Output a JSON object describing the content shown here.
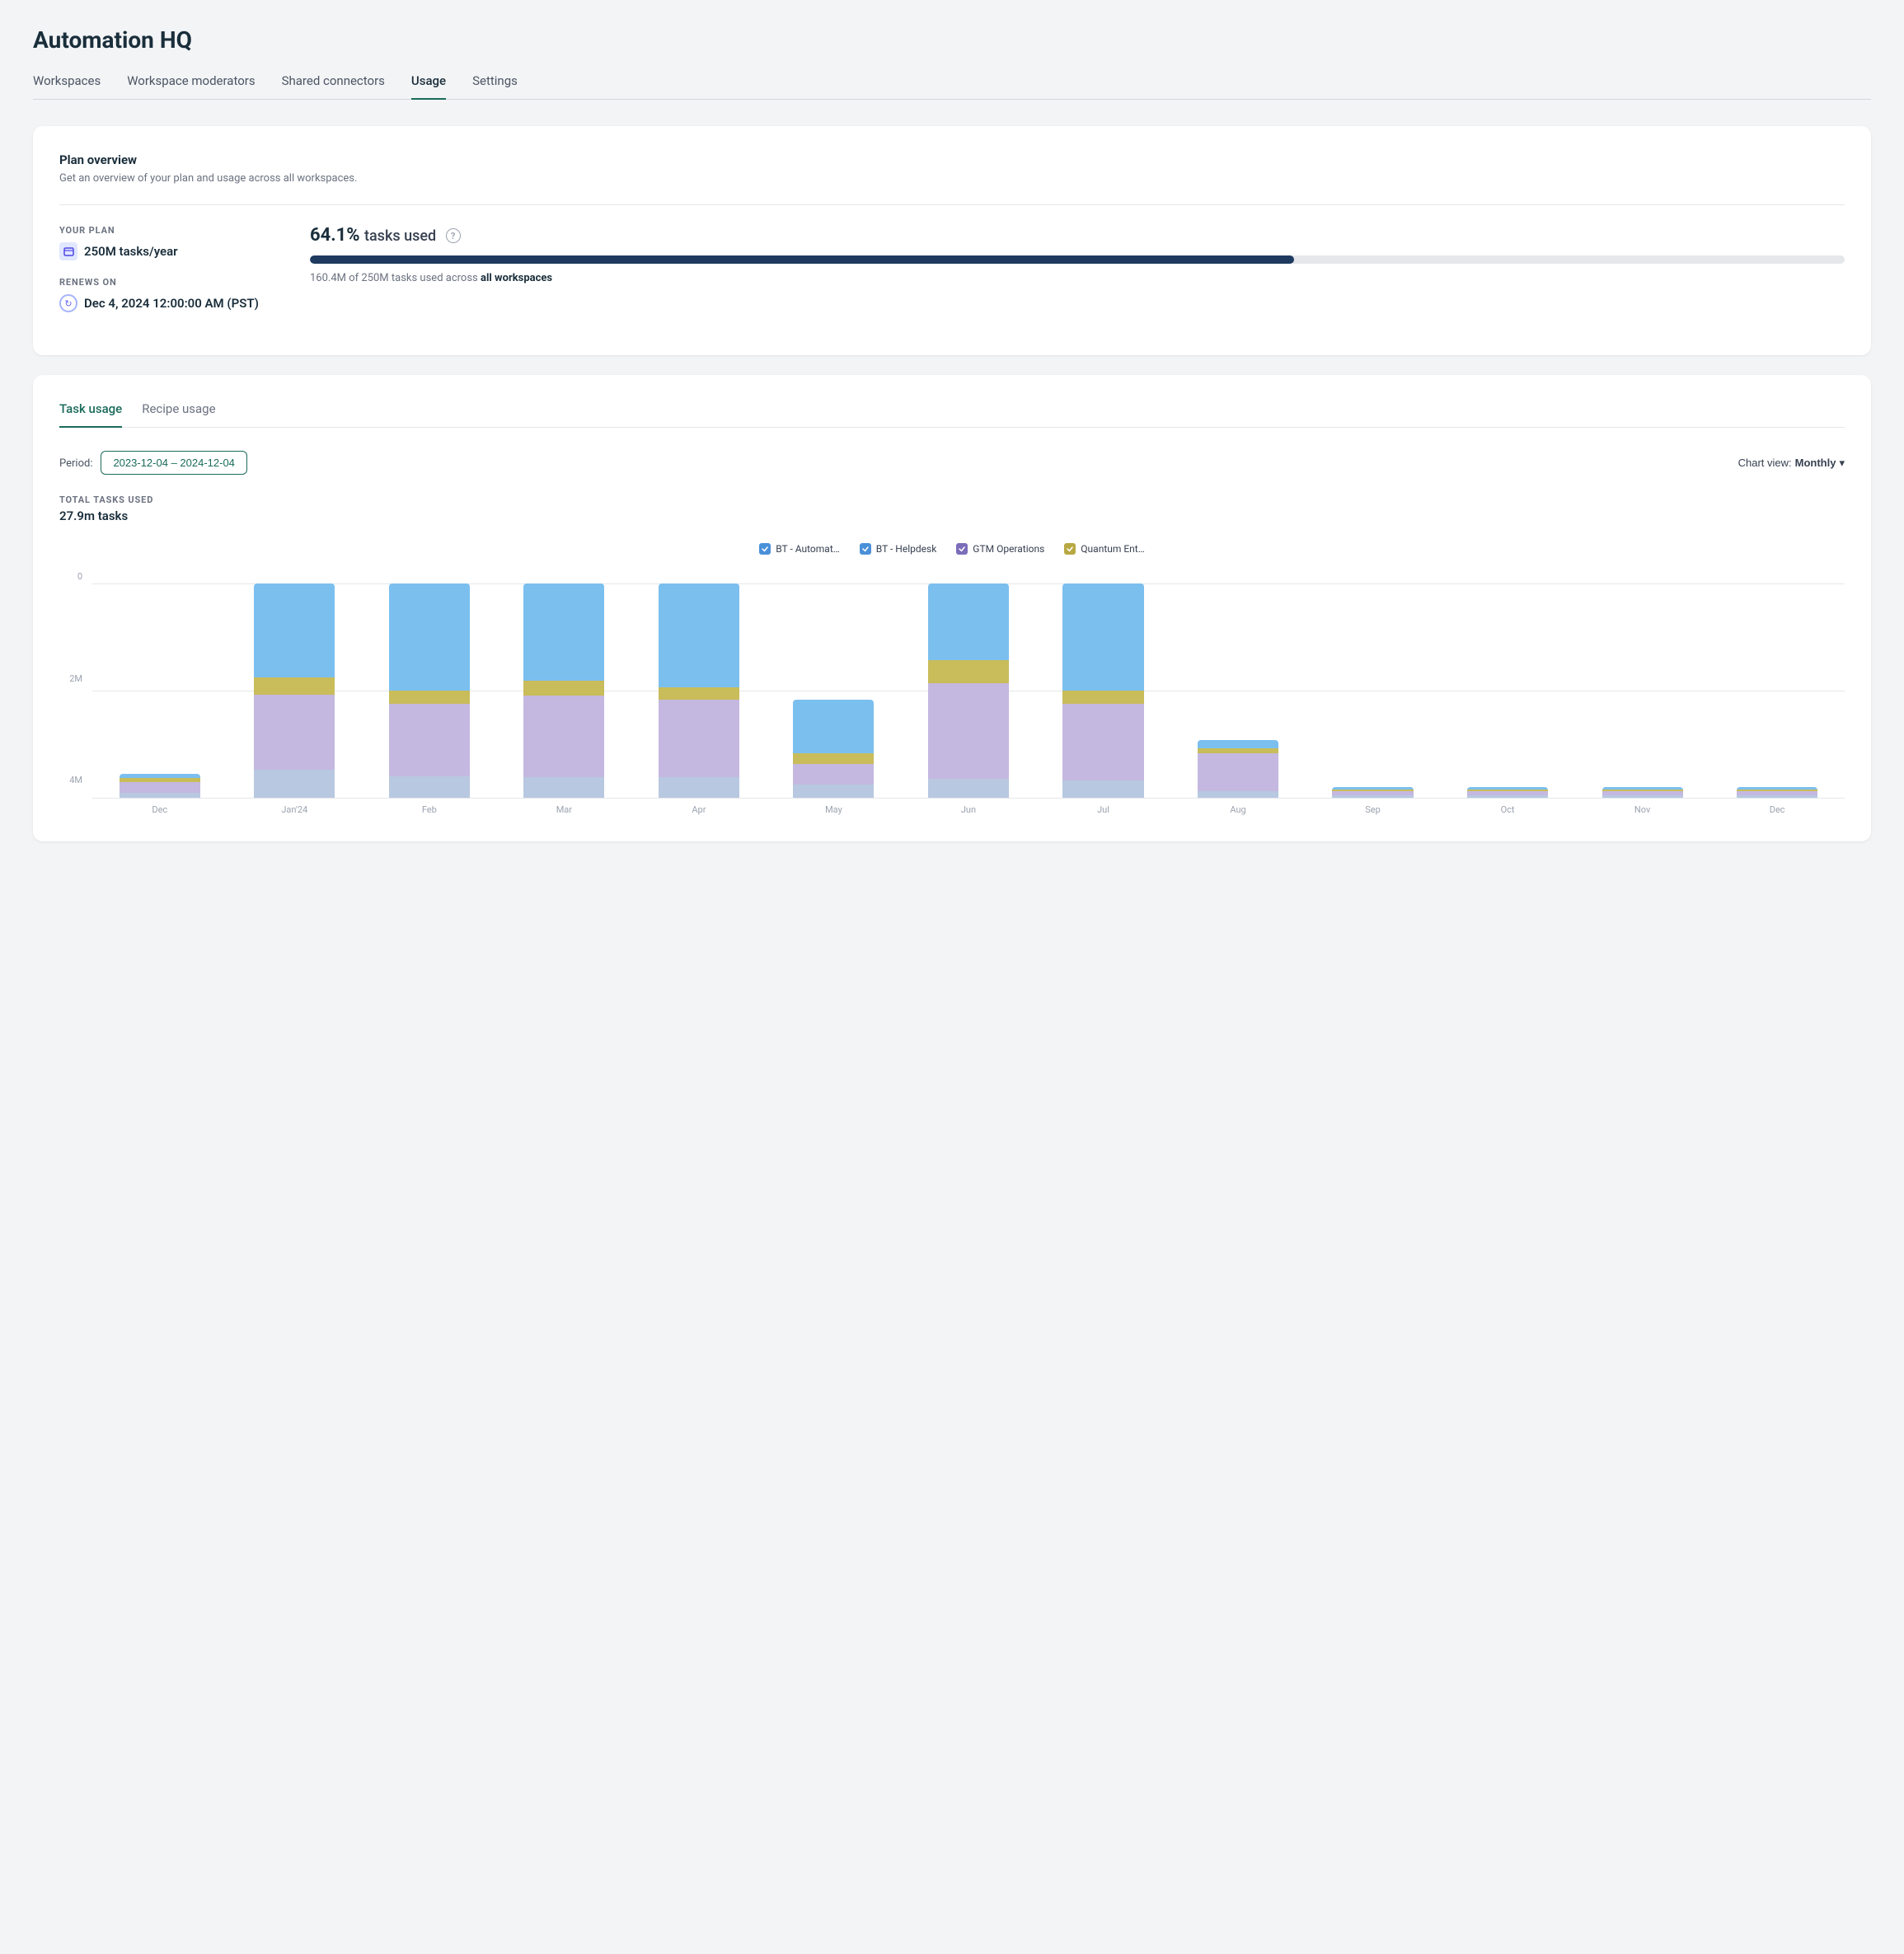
{
  "page": {
    "title": "Automation HQ"
  },
  "nav": {
    "tabs": [
      {
        "id": "workspaces",
        "label": "Workspaces",
        "active": false
      },
      {
        "id": "workspace-moderators",
        "label": "Workspace moderators",
        "active": false
      },
      {
        "id": "shared-connectors",
        "label": "Shared connectors",
        "active": false
      },
      {
        "id": "usage",
        "label": "Usage",
        "active": true
      },
      {
        "id": "settings",
        "label": "Settings",
        "active": false
      }
    ]
  },
  "plan_overview": {
    "title": "Plan overview",
    "description": "Get an overview of your plan and usage across all workspaces.",
    "your_plan_label": "YOUR PLAN",
    "plan_value": "250M tasks/year",
    "renews_on_label": "RENEWS ON",
    "renews_value": "Dec 4, 2024 12:00:00 AM (PST)",
    "usage_pct": "64.1%",
    "usage_label": "tasks used",
    "progress_pct": 64.1,
    "usage_detail": "160.4M of 250M tasks used across",
    "usage_detail_bold": "all workspaces"
  },
  "task_usage": {
    "tabs": [
      {
        "id": "task-usage",
        "label": "Task usage",
        "active": true
      },
      {
        "id": "recipe-usage",
        "label": "Recipe usage",
        "active": false
      }
    ],
    "period_label": "Period:",
    "period_value": "2023-12-04 – 2024-12-04",
    "chart_view_label": "Chart view:",
    "chart_view_value": "Monthly",
    "total_label": "TOTAL TASKS USED",
    "total_value": "27.9m tasks",
    "legend": [
      {
        "id": "bt-auto",
        "label": "BT - Automat…",
        "color": "#4a90d9"
      },
      {
        "id": "bt-helpdesk",
        "label": "BT - Helpdesk",
        "color": "#4a90d9"
      },
      {
        "id": "gtm-ops",
        "label": "GTM Operations",
        "color": "#7c6dba"
      },
      {
        "id": "quantum",
        "label": "Quantum Ent…",
        "color": "#b8a842"
      }
    ],
    "x_labels": [
      "Dec",
      "Jan'24",
      "Feb",
      "Mar",
      "Apr",
      "May",
      "Jun",
      "Jul",
      "Aug",
      "Sep",
      "Oct",
      "Nov",
      "Dec"
    ],
    "y_labels": [
      "0",
      "2M",
      "4M"
    ],
    "bars": [
      {
        "month": "Dec",
        "segments": [
          {
            "color": "#b8c8e0",
            "h": 4
          },
          {
            "color": "#c4b8e0",
            "h": 8
          },
          {
            "color": "#c9bc5a",
            "h": 3
          },
          {
            "color": "#7bbfef",
            "h": 3
          }
        ]
      },
      {
        "month": "Jan'24",
        "segments": [
          {
            "color": "#b8c8e0",
            "h": 30
          },
          {
            "color": "#c4b8e0",
            "h": 80
          },
          {
            "color": "#c9bc5a",
            "h": 18
          },
          {
            "color": "#7bbfef",
            "h": 100
          }
        ]
      },
      {
        "month": "Feb",
        "segments": [
          {
            "color": "#b8c8e0",
            "h": 25
          },
          {
            "color": "#c4b8e0",
            "h": 85
          },
          {
            "color": "#c9bc5a",
            "h": 16
          },
          {
            "color": "#7bbfef",
            "h": 125
          }
        ]
      },
      {
        "month": "Mar",
        "segments": [
          {
            "color": "#b8c8e0",
            "h": 20
          },
          {
            "color": "#c4b8e0",
            "h": 80
          },
          {
            "color": "#c9bc5a",
            "h": 14
          },
          {
            "color": "#7bbfef",
            "h": 95
          }
        ]
      },
      {
        "month": "Apr",
        "segments": [
          {
            "color": "#b8c8e0",
            "h": 20
          },
          {
            "color": "#c4b8e0",
            "h": 75
          },
          {
            "color": "#c9bc5a",
            "h": 12
          },
          {
            "color": "#7bbfef",
            "h": 100
          }
        ]
      },
      {
        "month": "May",
        "segments": [
          {
            "color": "#b8c8e0",
            "h": 10
          },
          {
            "color": "#c4b8e0",
            "h": 15
          },
          {
            "color": "#c9bc5a",
            "h": 8
          },
          {
            "color": "#7bbfef",
            "h": 40
          }
        ]
      },
      {
        "month": "Jun",
        "segments": [
          {
            "color": "#b8c8e0",
            "h": 15
          },
          {
            "color": "#c4b8e0",
            "h": 75
          },
          {
            "color": "#c9bc5a",
            "h": 18
          },
          {
            "color": "#7bbfef",
            "h": 60
          }
        ]
      },
      {
        "month": "Jul",
        "segments": [
          {
            "color": "#b8c8e0",
            "h": 20
          },
          {
            "color": "#c4b8e0",
            "h": 90
          },
          {
            "color": "#c9bc5a",
            "h": 16
          },
          {
            "color": "#7bbfef",
            "h": 125
          }
        ]
      },
      {
        "month": "Aug",
        "segments": [
          {
            "color": "#b8c8e0",
            "h": 5
          },
          {
            "color": "#c4b8e0",
            "h": 28
          },
          {
            "color": "#c9bc5a",
            "h": 4
          },
          {
            "color": "#7bbfef",
            "h": 6
          }
        ]
      },
      {
        "month": "Sep",
        "segments": [
          {
            "color": "#b8c8e0",
            "h": 2
          },
          {
            "color": "#c4b8e0",
            "h": 3
          },
          {
            "color": "#c9bc5a",
            "h": 1
          },
          {
            "color": "#7bbfef",
            "h": 2
          }
        ]
      },
      {
        "month": "Oct",
        "segments": [
          {
            "color": "#b8c8e0",
            "h": 2
          },
          {
            "color": "#c4b8e0",
            "h": 3
          },
          {
            "color": "#c9bc5a",
            "h": 1
          },
          {
            "color": "#7bbfef",
            "h": 2
          }
        ]
      },
      {
        "month": "Nov",
        "segments": [
          {
            "color": "#b8c8e0",
            "h": 2
          },
          {
            "color": "#c4b8e0",
            "h": 3
          },
          {
            "color": "#c9bc5a",
            "h": 1
          },
          {
            "color": "#7bbfef",
            "h": 2
          }
        ]
      },
      {
        "month": "Dec2",
        "segments": [
          {
            "color": "#b8c8e0",
            "h": 2
          },
          {
            "color": "#c4b8e0",
            "h": 3
          },
          {
            "color": "#c9bc5a",
            "h": 1
          },
          {
            "color": "#7bbfef",
            "h": 2
          }
        ]
      }
    ]
  }
}
